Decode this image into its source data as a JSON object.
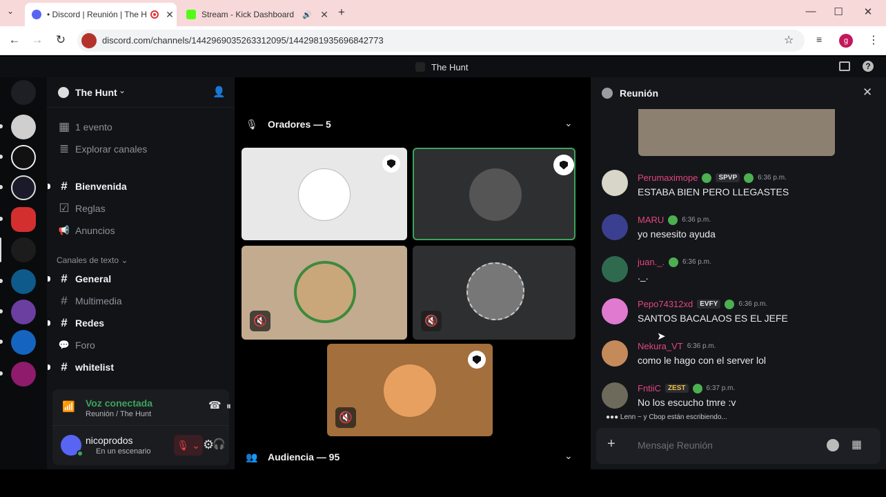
{
  "browser": {
    "tabs": [
      {
        "title": "• Discord | Reunión | The H",
        "active": true
      },
      {
        "title": "Stream - Kick Dashboard",
        "active": false
      }
    ],
    "new_tab": "+",
    "url": "discord.com/channels/1442969035263312095/1442981935696842773"
  },
  "discord": {
    "window_title": "The Hunt",
    "server_name": "The Hunt",
    "events": "1 evento",
    "browse": "Explorar canales",
    "channels_top": [
      {
        "name": "Bienvenida",
        "icon": "#",
        "bold": true
      },
      {
        "name": "Reglas",
        "icon": "☑",
        "bold": false
      },
      {
        "name": "Anuncios",
        "icon": "📢",
        "bold": false
      }
    ],
    "text_category": "Canales de texto",
    "text_channels": [
      {
        "name": "General",
        "icon": "#",
        "bold": true
      },
      {
        "name": "Multimedia",
        "icon": "#",
        "bold": false
      },
      {
        "name": "Redes",
        "icon": "#",
        "bold": true
      },
      {
        "name": "Foro",
        "icon": "💬",
        "bold": false
      },
      {
        "name": "whitelist",
        "icon": "#",
        "bold": true
      }
    ],
    "voice": {
      "status": "Voz conectada",
      "location": "Reunión / The Hunt"
    },
    "user": {
      "name": "nicoprodos",
      "status": "En un escenario"
    },
    "stage": {
      "speakers_label": "Oradores — 5",
      "audience_label": "Audiencia — 95"
    },
    "chat": {
      "title": "Reunión",
      "placeholder": "Mensaje Reunión",
      "typing": "Lenn ~ y Cbop están escribiendo...",
      "messages": [
        {
          "author": "Perumaximope",
          "badge": "SPVP",
          "time": "6:36 p.m.",
          "text": "ESTABA BIEN PERO LLEGASTES"
        },
        {
          "author": "MARU",
          "badge": "",
          "time": "6:36 p.m.",
          "text": "yo nesesito ayuda"
        },
        {
          "author": "juan._.",
          "badge": "",
          "time": "6:36 p.m.",
          "text": "._."
        },
        {
          "author": "Pepo74312xd",
          "badge": "EVFY",
          "time": "6:36 p.m.",
          "text": "SANTOS BACALAOS ES EL JEFE"
        },
        {
          "author": "Nekura_VT",
          "badge": "",
          "time": "6:36 p.m.",
          "text": "como le hago con el server lol"
        },
        {
          "author": "FntiiC",
          "badge": "ZEST",
          "time": "6:37 p.m.",
          "text": "No los escucho tmre :v"
        }
      ]
    }
  }
}
